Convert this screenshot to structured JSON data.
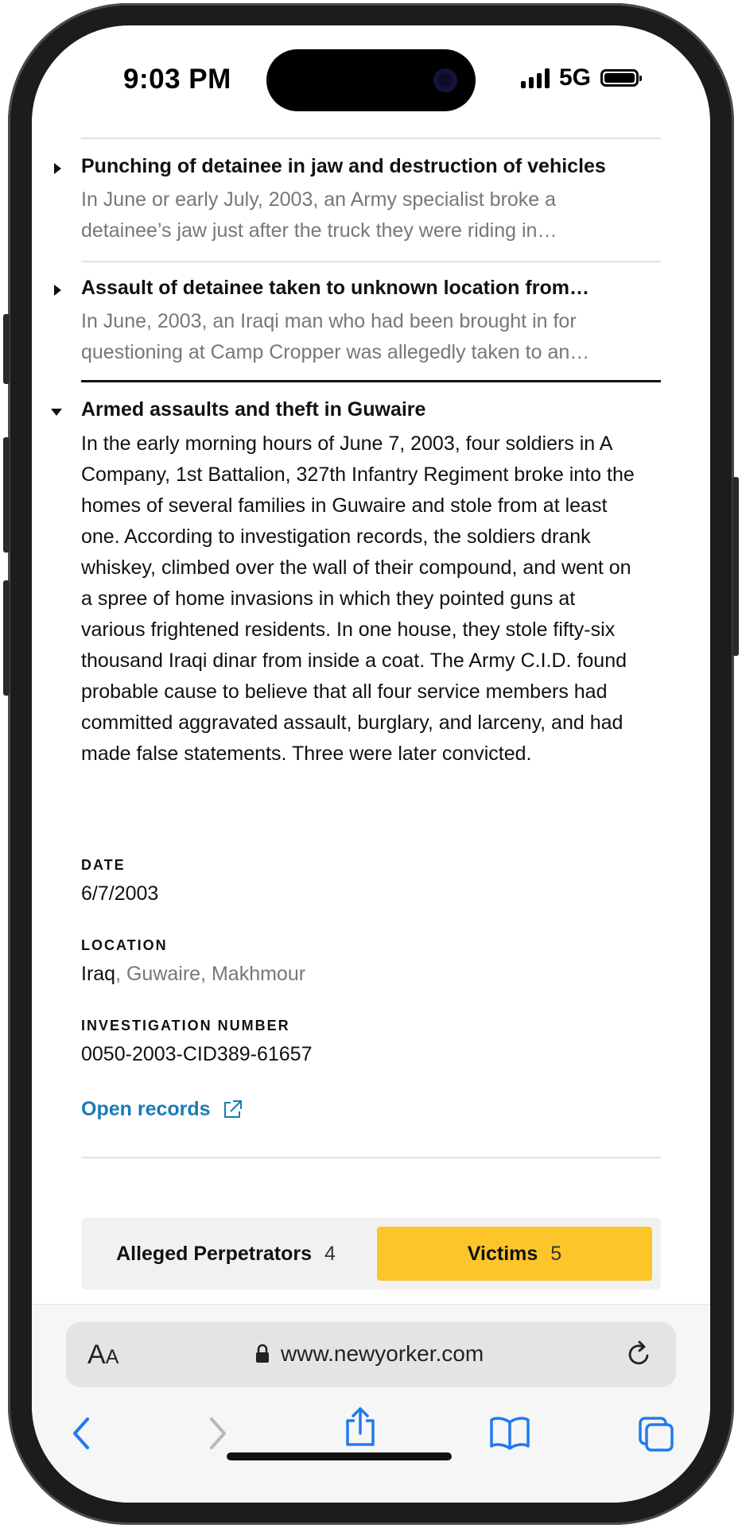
{
  "status_bar": {
    "time": "9:03 PM",
    "network": "5G"
  },
  "items": [
    {
      "title": "Punching of detainee in jaw and destruction of vehicles",
      "summary": "In June or early July, 2003, an Army specialist broke a detainee’s jaw just after the truck they were riding in…"
    },
    {
      "title": "Assault of detainee taken to unknown location from…",
      "summary": "In June, 2003, an Iraqi man who had been brought in for questioning at Camp Cropper was allegedly taken to an…"
    }
  ],
  "expanded": {
    "title": "Armed assaults and theft in Guwaire",
    "body": "In the early morning hours of June 7, 2003, four soldiers in A Company, 1st Battalion, 327th Infantry Regiment broke into the homes of several families in Guwaire and stole from at least one. According to investigation records, the soldiers drank whiskey, climbed over the wall of their compound, and went on a spree of home invasions in which they pointed guns at various frightened residents. In one house, they stole fifty-six thousand Iraqi dinar from inside a coat. The Army C.I.D. found probable cause to believe that all four service members had committed aggravated assault, burglary, and larceny, and had made false statements. Three were later convicted.",
    "date_label": "DATE",
    "date": "6/7/2003",
    "location_label": "LOCATION",
    "location_country": "Iraq",
    "location_detail": ", Guwaire, Makhmour",
    "investigation_label": "INVESTIGATION NUMBER",
    "investigation_number": "0050-2003-CID389-61657",
    "open_records": "Open records"
  },
  "tabs": [
    {
      "label": "Alleged Perpetrators",
      "count": "4",
      "active": false
    },
    {
      "label": "Victims",
      "count": "5",
      "active": true
    }
  ],
  "safari": {
    "aa_large": "A",
    "aa_small": "A",
    "url": "www.newyorker.com"
  },
  "colors": {
    "accent_link": "#1a7ab8",
    "active_tab": "#fcc62a",
    "safari_blue": "#1f7bf0"
  }
}
